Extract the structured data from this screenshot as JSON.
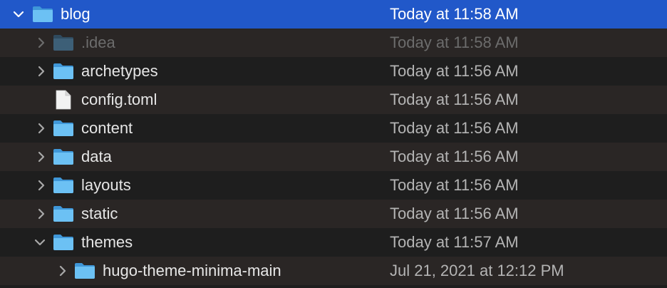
{
  "colors": {
    "selection": "#2158c9",
    "row_even": "#1e1e1e",
    "row_odd": "#2a2625",
    "folder": "#5bb5ee",
    "text": "#e6e6e6",
    "date_text": "#b4b4b4",
    "dim_text": "#6c6c6c"
  },
  "files": [
    {
      "name": "blog",
      "modified": "Today at 11:58 AM",
      "kind": "folder",
      "expanded": true,
      "selected": true,
      "depth": 0,
      "icon": "folder-icon"
    },
    {
      "name": ".idea",
      "modified": "Today at 11:58 AM",
      "kind": "folder",
      "expanded": false,
      "hidden": true,
      "depth": 1,
      "icon": "folder-icon"
    },
    {
      "name": "archetypes",
      "modified": "Today at 11:56 AM",
      "kind": "folder",
      "expanded": false,
      "depth": 1,
      "icon": "folder-icon"
    },
    {
      "name": "config.toml",
      "modified": "Today at 11:56 AM",
      "kind": "file",
      "depth": 1,
      "icon": "document-icon"
    },
    {
      "name": "content",
      "modified": "Today at 11:56 AM",
      "kind": "folder",
      "expanded": false,
      "depth": 1,
      "icon": "folder-icon"
    },
    {
      "name": "data",
      "modified": "Today at 11:56 AM",
      "kind": "folder",
      "expanded": false,
      "depth": 1,
      "icon": "folder-icon"
    },
    {
      "name": "layouts",
      "modified": "Today at 11:56 AM",
      "kind": "folder",
      "expanded": false,
      "depth": 1,
      "icon": "folder-icon"
    },
    {
      "name": "static",
      "modified": "Today at 11:56 AM",
      "kind": "folder",
      "expanded": false,
      "depth": 1,
      "icon": "folder-icon"
    },
    {
      "name": "themes",
      "modified": "Today at 11:57 AM",
      "kind": "folder",
      "expanded": true,
      "depth": 1,
      "icon": "folder-icon"
    },
    {
      "name": "hugo-theme-minima-main",
      "modified": "Jul 21, 2021 at 12:12 PM",
      "kind": "folder",
      "expanded": false,
      "depth": 2,
      "icon": "folder-icon"
    }
  ]
}
